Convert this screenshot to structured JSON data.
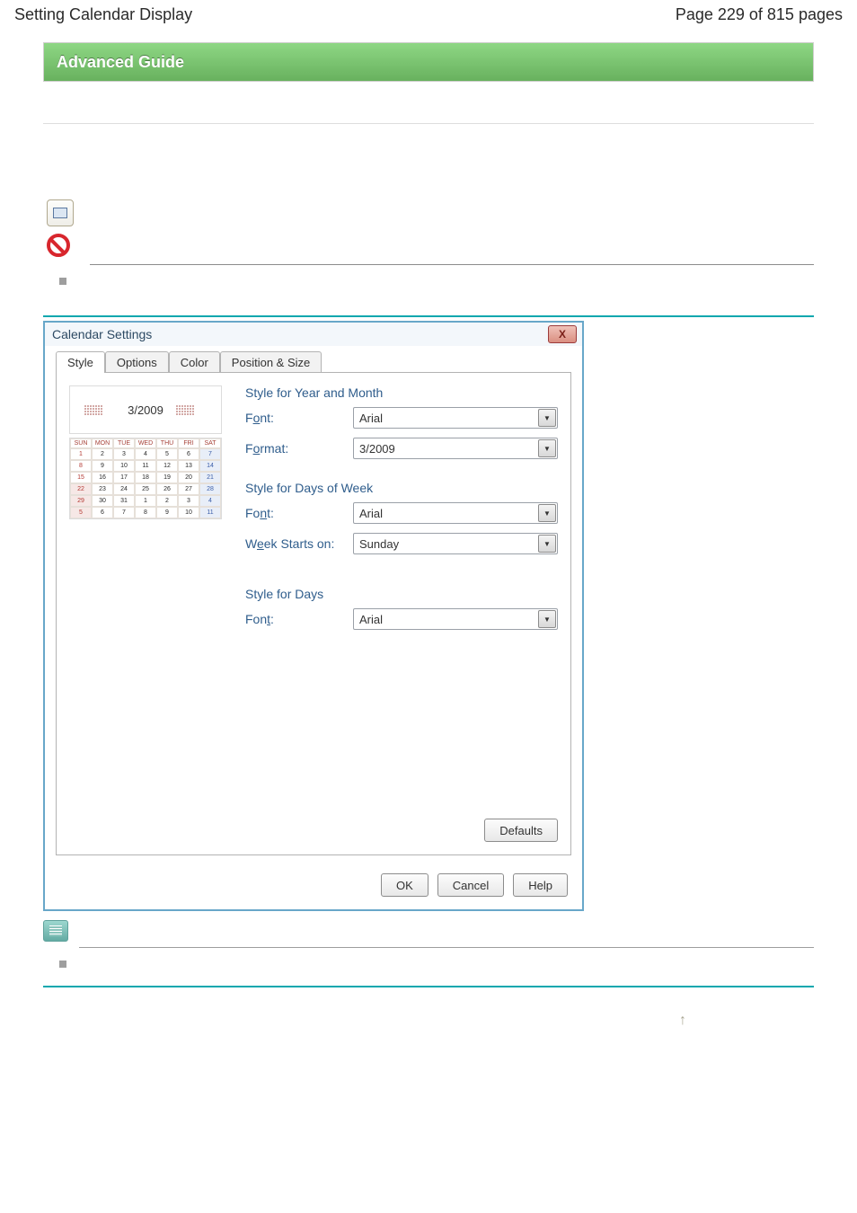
{
  "header": {
    "title": "Setting Calendar Display",
    "page_info": "Page 229 of 815 pages"
  },
  "guide_bar": "Advanced Guide",
  "dialog": {
    "title": "Calendar Settings",
    "close": "X",
    "tabs": [
      "Style",
      "Options",
      "Color",
      "Position & Size"
    ],
    "preview_year_month": "3/2009",
    "cal_header": [
      "SUN",
      "MON",
      "TUE",
      "WED",
      "THU",
      "FRI",
      "SAT"
    ],
    "cal_cells": [
      {
        "v": "1",
        "c": "rd"
      },
      {
        "v": "2"
      },
      {
        "v": "3"
      },
      {
        "v": "4"
      },
      {
        "v": "5"
      },
      {
        "v": "6"
      },
      {
        "v": "7",
        "c": "fbl"
      },
      {
        "v": "8",
        "c": "rd"
      },
      {
        "v": "9"
      },
      {
        "v": "10"
      },
      {
        "v": "11"
      },
      {
        "v": "12"
      },
      {
        "v": "13"
      },
      {
        "v": "14",
        "c": "fbl"
      },
      {
        "v": "15",
        "c": "rd"
      },
      {
        "v": "16"
      },
      {
        "v": "17"
      },
      {
        "v": "18"
      },
      {
        "v": "19"
      },
      {
        "v": "20"
      },
      {
        "v": "21",
        "c": "fbl"
      },
      {
        "v": "22",
        "c": "frd"
      },
      {
        "v": "23"
      },
      {
        "v": "24"
      },
      {
        "v": "25"
      },
      {
        "v": "26"
      },
      {
        "v": "27"
      },
      {
        "v": "28",
        "c": "fbl"
      },
      {
        "v": "29",
        "c": "frd"
      },
      {
        "v": "30"
      },
      {
        "v": "31"
      },
      {
        "v": "1"
      },
      {
        "v": "2"
      },
      {
        "v": "3"
      },
      {
        "v": "4",
        "c": "fbl"
      },
      {
        "v": "5",
        "c": "frd"
      },
      {
        "v": "6"
      },
      {
        "v": "7"
      },
      {
        "v": "8"
      },
      {
        "v": "9"
      },
      {
        "v": "10"
      },
      {
        "v": "11",
        "c": "fbl"
      }
    ],
    "sections": {
      "ym": {
        "title": "Style for Year and Month",
        "font_label": {
          "pre": "F",
          "ul": "o",
          "post": "nt:"
        },
        "font_value": "Arial",
        "format_label": {
          "pre": "F",
          "ul": "o",
          "post": "rmat:"
        },
        "format_value": "3/2009"
      },
      "dow": {
        "title": "Style for Days of Week",
        "font_label": {
          "pre": "Fo",
          "ul": "n",
          "post": "t:"
        },
        "font_value": "Arial",
        "week_label": {
          "pre": "W",
          "ul": "e",
          "post": "ek Starts on:"
        },
        "week_value": "Sunday"
      },
      "days": {
        "title": "Style for Days",
        "font_label": {
          "pre": "Fon",
          "ul": "t",
          "post": ":"
        },
        "font_value": "Arial"
      }
    },
    "defaults": "Defaults",
    "buttons": {
      "ok": "OK",
      "cancel": "Cancel",
      "help": "Help"
    }
  }
}
